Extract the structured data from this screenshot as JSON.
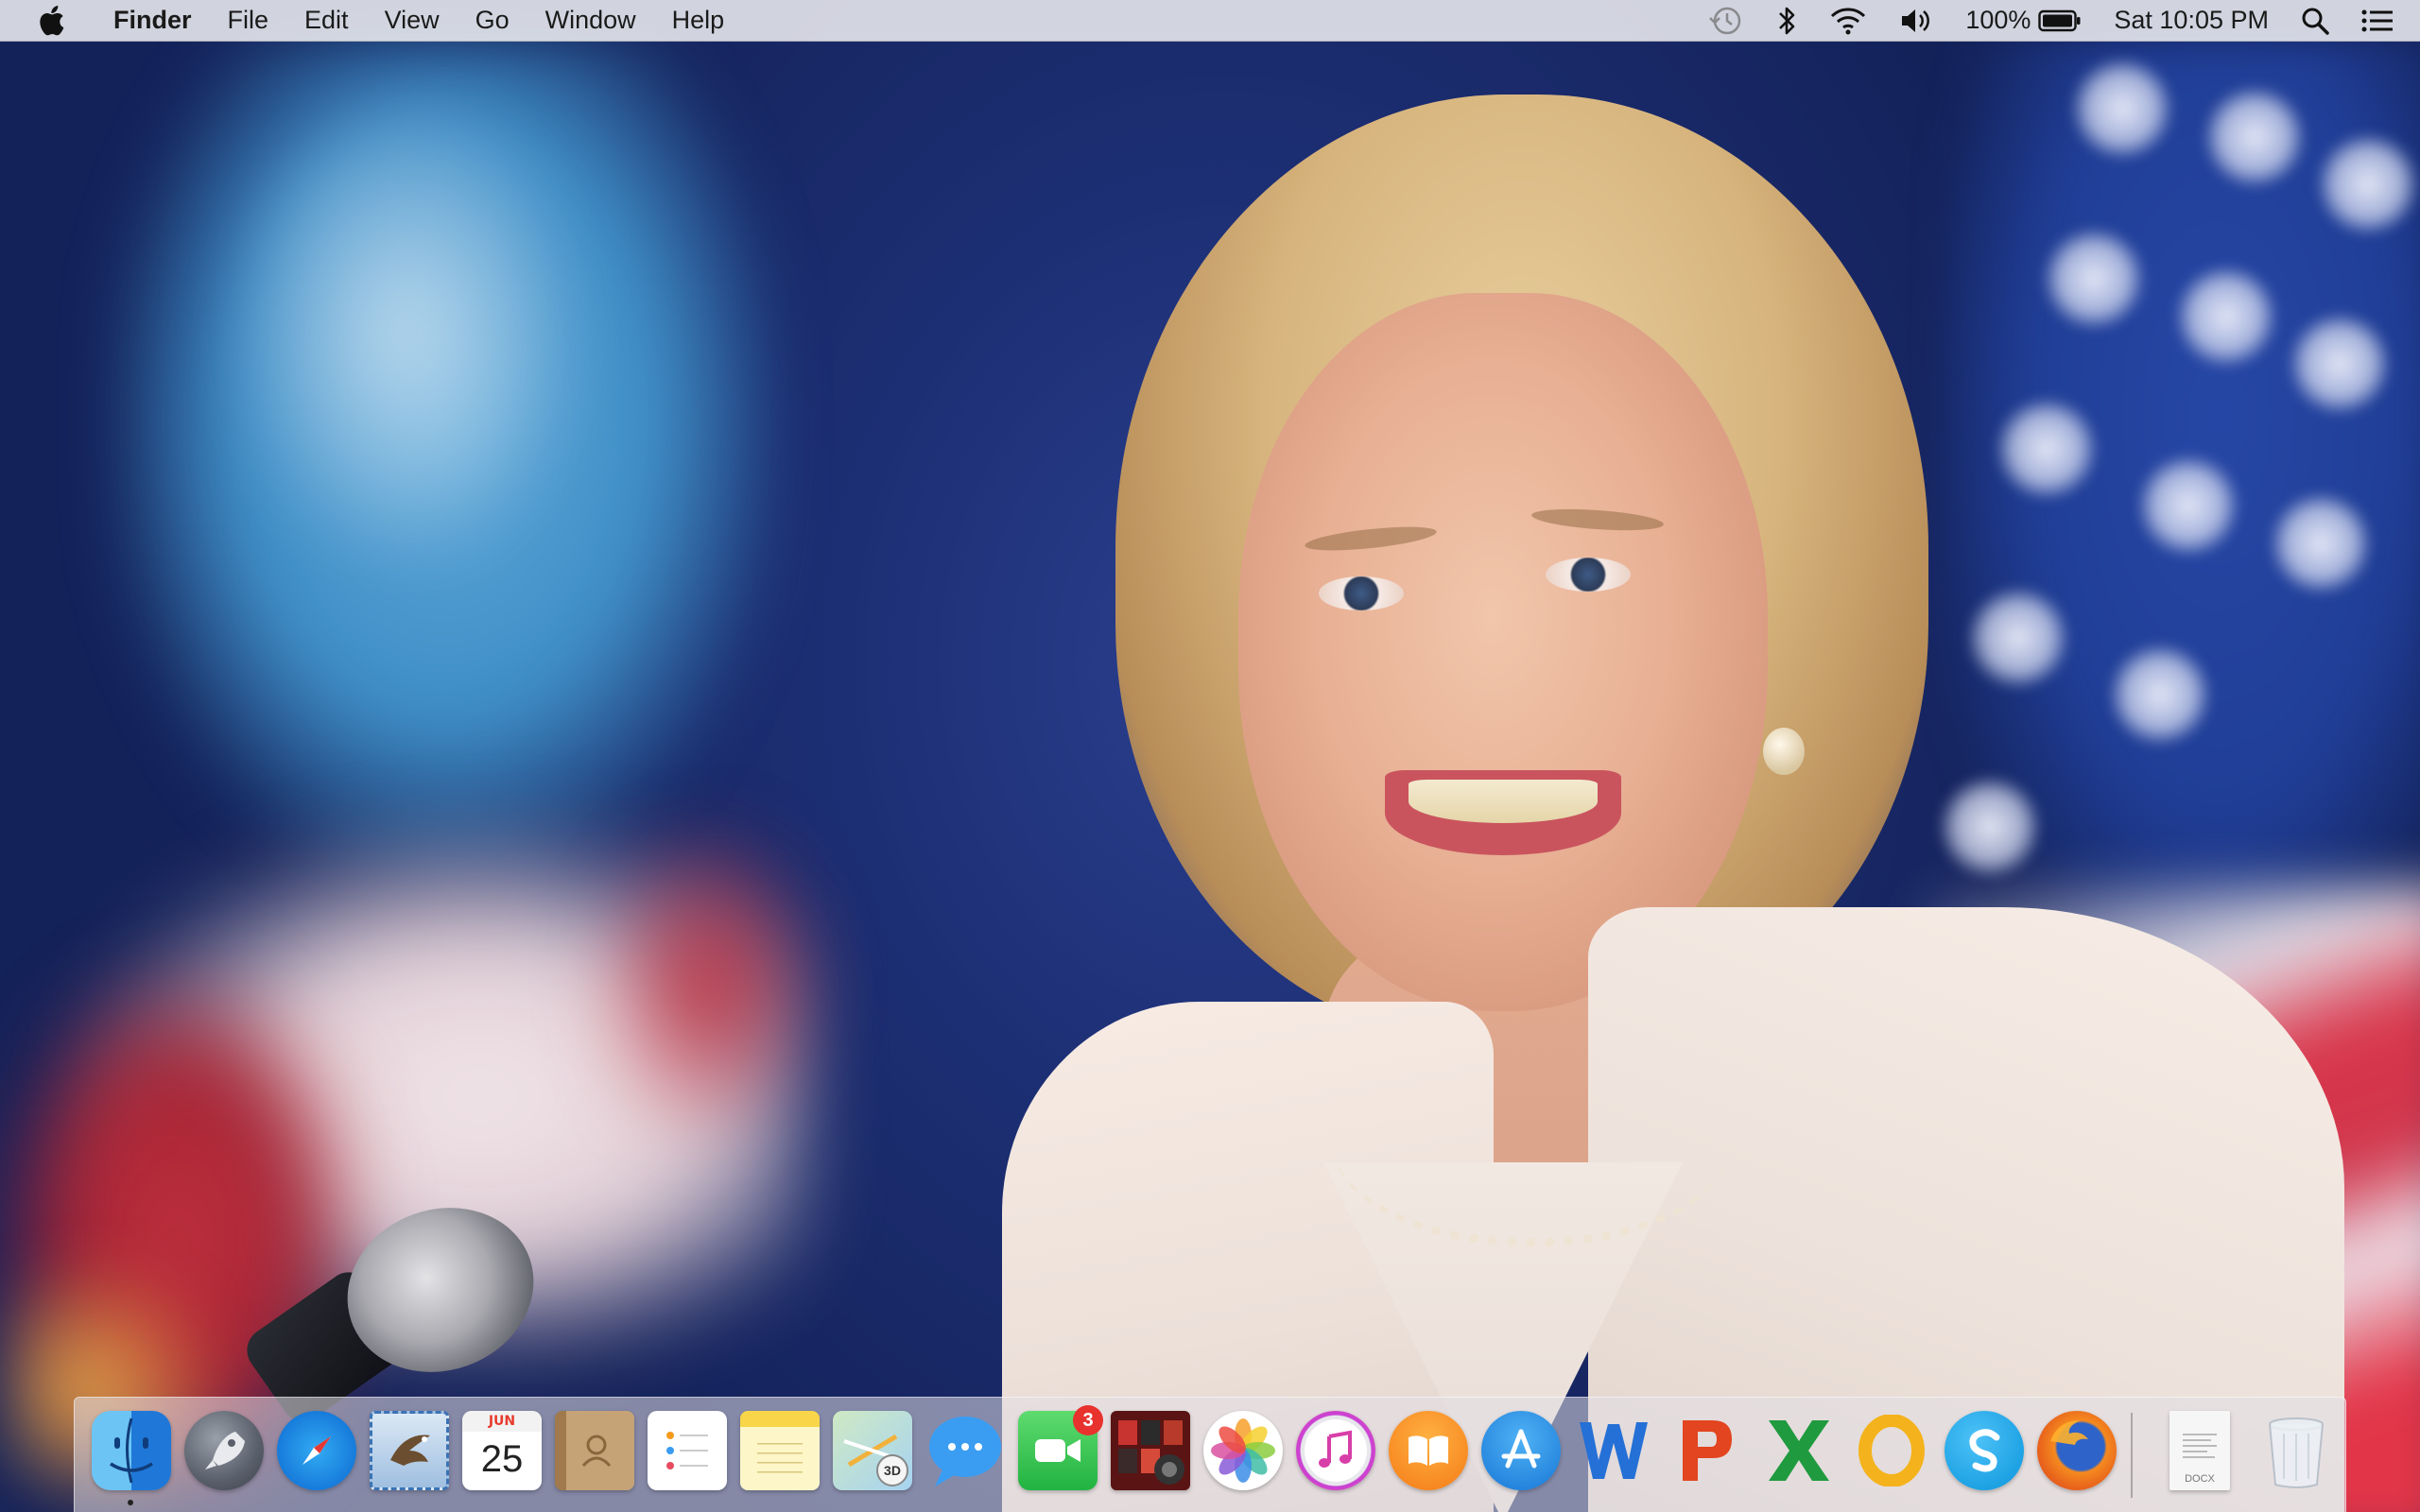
{
  "menubar": {
    "apple_icon": "apple-icon",
    "app_name": "Finder",
    "items": [
      "File",
      "Edit",
      "View",
      "Go",
      "Window",
      "Help"
    ],
    "status": {
      "time_machine_icon": "time-machine-icon",
      "bluetooth_icon": "bluetooth-icon",
      "wifi_icon": "wifi-icon",
      "volume_icon": "volume-icon",
      "battery_percent": "100%",
      "battery_icon": "battery-icon",
      "clock": "Sat 10:05 PM",
      "spotlight_icon": "spotlight-search-icon",
      "notification_center_icon": "notification-center-icon"
    }
  },
  "dock": {
    "apps": [
      {
        "name": "Finder",
        "icon": "finder-icon",
        "running": true
      },
      {
        "name": "Launchpad",
        "icon": "launchpad-icon"
      },
      {
        "name": "Safari",
        "icon": "safari-icon"
      },
      {
        "name": "Mail",
        "icon": "mail-icon"
      },
      {
        "name": "Calendar",
        "icon": "calendar-icon",
        "month": "JUN",
        "day": "25"
      },
      {
        "name": "Contacts",
        "icon": "contacts-icon"
      },
      {
        "name": "Reminders",
        "icon": "reminders-icon"
      },
      {
        "name": "Notes",
        "icon": "notes-icon"
      },
      {
        "name": "Maps",
        "icon": "maps-icon",
        "label": "3D"
      },
      {
        "name": "Messages",
        "icon": "messages-icon"
      },
      {
        "name": "FaceTime",
        "icon": "facetime-icon",
        "badge": "3"
      },
      {
        "name": "Photo Booth",
        "icon": "photo-booth-icon"
      },
      {
        "name": "Photos",
        "icon": "photos-icon"
      },
      {
        "name": "iTunes",
        "icon": "itunes-icon"
      },
      {
        "name": "iBooks",
        "icon": "ibooks-icon"
      },
      {
        "name": "App Store",
        "icon": "app-store-icon"
      },
      {
        "name": "Microsoft Word",
        "icon": "word-icon"
      },
      {
        "name": "Microsoft PowerPoint",
        "icon": "powerpoint-icon"
      },
      {
        "name": "Microsoft Excel",
        "icon": "excel-icon"
      },
      {
        "name": "Microsoft Outlook",
        "icon": "outlook-icon"
      },
      {
        "name": "Skype",
        "icon": "skype-icon"
      },
      {
        "name": "Firefox",
        "icon": "firefox-icon"
      }
    ],
    "documents": {
      "label": "DOCX",
      "icon": "docx-file-icon"
    },
    "trash": {
      "icon": "trash-icon"
    }
  },
  "colors": {
    "menubar_bg": "#ececf0",
    "badge": "#e8322e",
    "wallpaper_blue": "#1d2f74"
  }
}
